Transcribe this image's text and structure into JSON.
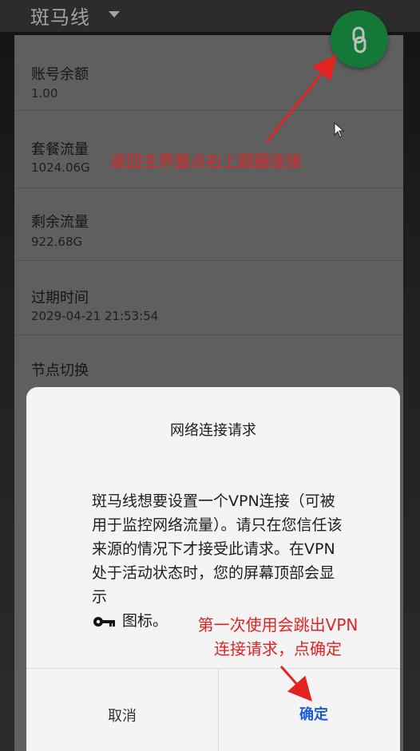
{
  "app": {
    "title": "斑马线"
  },
  "items": [
    {
      "label": "账号余额",
      "value": "1.00"
    },
    {
      "label": "套餐流量",
      "value": "1024.06G"
    },
    {
      "label": "剩余流量",
      "value": "922.68G"
    },
    {
      "label": "过期时间",
      "value": "2029-04-21 21:53:54"
    },
    {
      "label": "节点切换",
      "value": ""
    }
  ],
  "fab": {
    "icon": "link-icon"
  },
  "dialog": {
    "title": "网络连接请求",
    "body": "斑马线想要设置一个VPN连接（可被用于监控网络流量）。请只在您信任该来源的情况下才接受此请求。在VPN处于活动状态时，您的屏幕顶部会显示",
    "key_suffix": "图标。",
    "cancel": "取消",
    "ok": "确定"
  },
  "annotations": {
    "top": "返回主界面点右上圆圈连接",
    "bottom_line1": "第一次使用会跳出VPN",
    "bottom_line2": "连接请求，点确定"
  },
  "colors": {
    "accent_green": "#1aa04b",
    "annotation_red": "#e32222",
    "button_blue": "#1c5bd8"
  }
}
